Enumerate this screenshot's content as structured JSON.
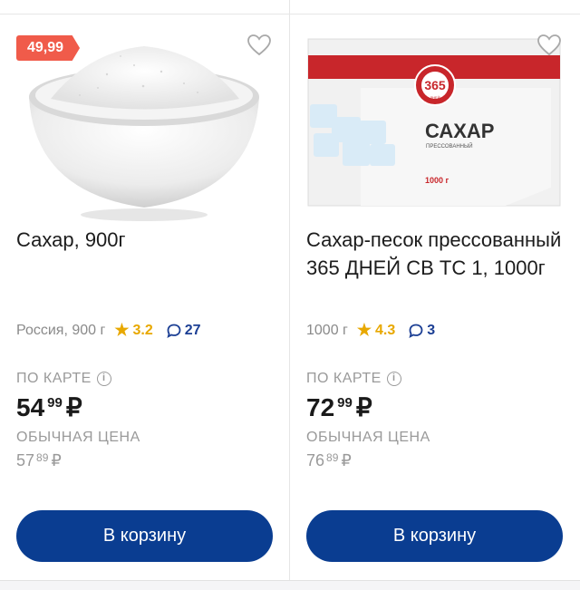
{
  "products": [
    {
      "badge": "49,99",
      "image_icon": "sugar-bowl-image",
      "title": "Сахар, 900г",
      "origin": "Россия, 900 г",
      "rating": "3.2",
      "reviews": "27",
      "card_label": "ПО КАРТЕ",
      "card_price_rub": "54",
      "card_price_kop": "99",
      "regular_label": "ОБЫЧНАЯ ЦЕНА",
      "regular_price_rub": "57",
      "regular_price_kop": "89",
      "currency": "₽",
      "button": "В корзину"
    },
    {
      "image_icon": "sugar-package-image",
      "package_brand": "365",
      "package_brand_sub": "ДНЕЙ",
      "package_title": "САХАР",
      "package_subtitle": "ПРЕССОВАННЫЙ",
      "package_weight": "1000 г",
      "title": "Сахар-песок прессованный 365 ДНЕЙ СВ ТС 1, 1000г",
      "origin": "1000 г",
      "rating": "4.3",
      "reviews": "3",
      "card_label": "ПО КАРТЕ",
      "card_price_rub": "72",
      "card_price_kop": "99",
      "regular_label": "ОБЫЧНАЯ ЦЕНА",
      "regular_price_rub": "76",
      "regular_price_kop": "89",
      "currency": "₽",
      "button": "В корзину"
    }
  ],
  "colors": {
    "accent": "#0a3d91",
    "badge": "#f05b4a",
    "rating": "#e8a800",
    "reviews": "#1c3f94",
    "muted": "#9a9a9a"
  }
}
